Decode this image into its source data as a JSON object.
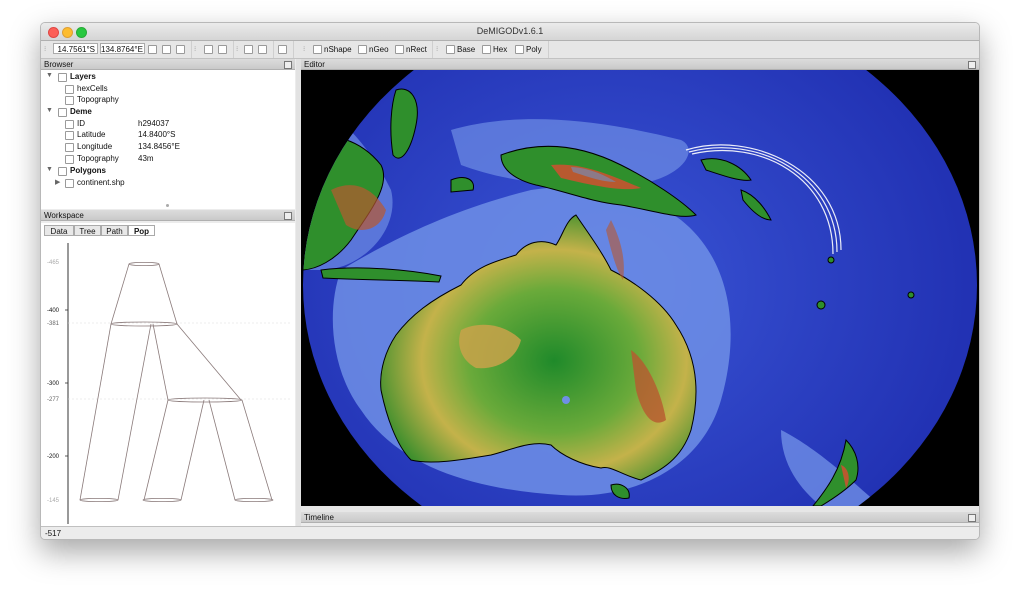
{
  "window": {
    "title": "DeMIGODv1.6.1"
  },
  "toolbar": {
    "lat_value": "14.7561°S",
    "lon_value": "134.8764°E",
    "nshape_label": "nShape",
    "ngeo_label": "nGeo",
    "nrect_label": "nRect",
    "base_label": "Base",
    "hex_label": "Hex",
    "poly_label": "Poly"
  },
  "browser": {
    "title": "Browser",
    "layers_label": "Layers",
    "hexcells_label": "hexCells",
    "topography_label": "Topography",
    "deme_label": "Deme",
    "id_label": "ID",
    "id_value": "h294037",
    "latitude_label": "Latitude",
    "latitude_value": "14.8400°S",
    "longitude_label": "Longitude",
    "longitude_value": "134.8456°E",
    "deme_topography_label": "Topography",
    "deme_topography_value": "43m",
    "polygons_label": "Polygons",
    "continent_label": "continent.shp"
  },
  "workspace": {
    "title": "Workspace",
    "tabs": [
      "Data",
      "Tree",
      "Path",
      "Pop"
    ],
    "active_tab": "Pop",
    "axis_ticks": [
      "-465",
      "-400",
      "-381",
      "-300",
      "-277",
      "-200",
      "-145"
    ]
  },
  "editor": {
    "title": "Editor"
  },
  "timeline": {
    "title": "Timeline"
  },
  "statusbar": {
    "value": "-517"
  },
  "colors": {
    "ocean_deep": "#2a3ec0",
    "ocean_shallow": "#6a8be0",
    "land_low": "#2e8b2a",
    "land_mid": "#c9b04a",
    "land_high": "#b8592f"
  }
}
